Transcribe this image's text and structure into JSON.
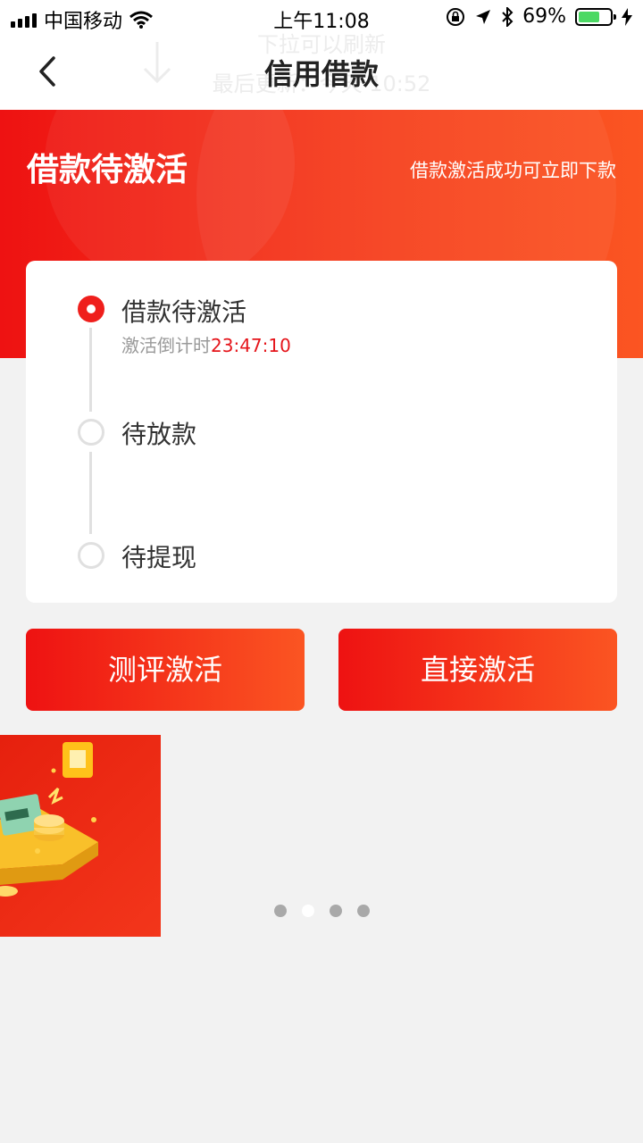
{
  "status_bar": {
    "carrier": "中国移动",
    "time": "上午11:08",
    "battery_percent": "69%",
    "battery_level": 0.69,
    "icons": [
      "signal-icon",
      "wifi-icon",
      "orientation-lock-icon",
      "location-icon",
      "bluetooth-icon",
      "battery-icon",
      "charging-icon"
    ]
  },
  "nav": {
    "title": "信用借款",
    "back_icon": "back-chevron-icon",
    "pull_hint_line1": "下拉可以刷新",
    "pull_hint_line2": "最后更新：今天 10:52"
  },
  "banner": {
    "title": "借款待激活",
    "subtitle": "借款激活成功可立即下款"
  },
  "progress": {
    "steps": [
      {
        "label": "借款待激活",
        "state": "active"
      },
      {
        "label": "待放款",
        "state": "pending"
      },
      {
        "label": "待提现",
        "state": "pending"
      }
    ],
    "countdown_label": "激活倒计时",
    "countdown_value": "23:47:10"
  },
  "actions": {
    "evaluate_label": "测评激活",
    "direct_label": "直接激活"
  },
  "carousel": {
    "page_count": 4,
    "active_index": 1
  },
  "colors": {
    "accent_red": "#ee1212",
    "accent_orange": "#fb5522",
    "countdown_red": "#e5141a",
    "page_bg": "#f2f2f2"
  }
}
